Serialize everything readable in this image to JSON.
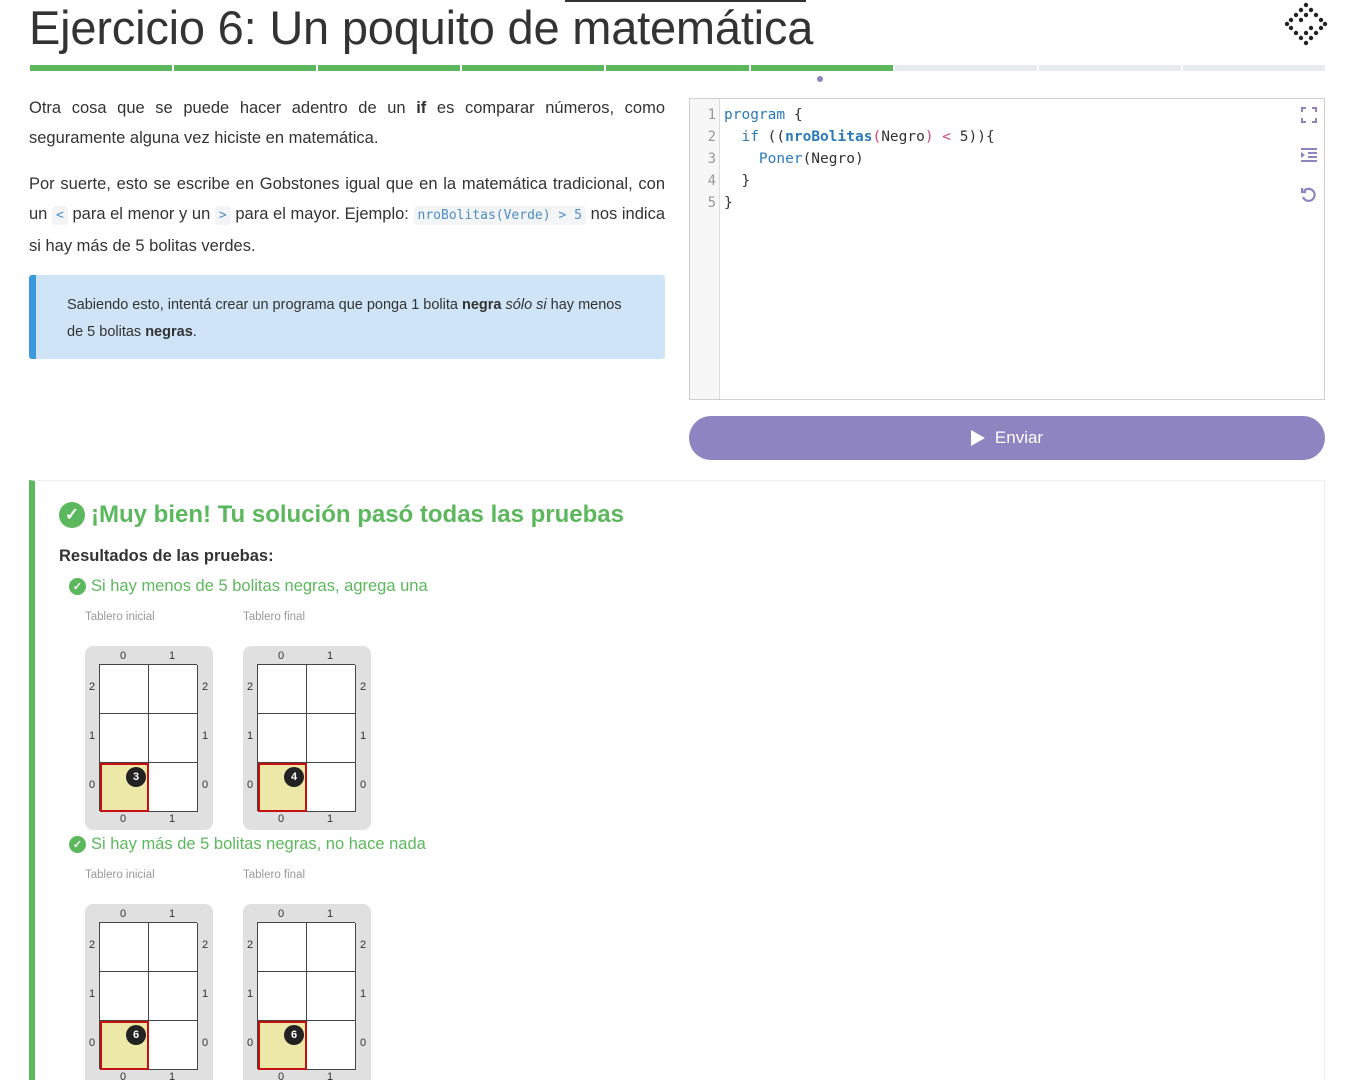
{
  "title": "Ejercicio 6: Un poquito de matemática",
  "progress": {
    "total": 9,
    "completed": 6
  },
  "description": {
    "p1_a": "Otra cosa que se puede hacer adentro de un ",
    "p1_kw": "if",
    "p1_b": " es comparar números, como seguramente alguna vez hiciste en matemática.",
    "p2_a": "Por suerte, esto se escribe en Gobstones igual que en la matemática tradicional, con un ",
    "p2_lt": "<",
    "p2_b": " para el menor y un ",
    "p2_gt": ">",
    "p2_c": " para el mayor. Ejemplo: ",
    "p2_example": "nroBolitas(Verde) > 5",
    "p2_d": " nos indica si hay más de 5 bolitas verdes."
  },
  "callout": {
    "a": "Sabiendo esto, intentá crear un programa que ponga 1 bolita ",
    "b": "negra",
    "c": "sólo si",
    "d": " hay menos de 5 bolitas ",
    "e": "negras",
    "f": "."
  },
  "editor": {
    "line_numbers": [
      "1",
      "2",
      "3",
      "4",
      "5"
    ],
    "lines": {
      "l1_kw": "program",
      "l1_rest": " {",
      "l2_indent": "  ",
      "l2_kw": "if",
      "l2_a": " ((",
      "l2_fn": "nroBolitas",
      "l2_paren1": "(",
      "l2_arg": "Negro",
      "l2_paren2": ")",
      "l2_op": " < ",
      "l2_num": "5",
      "l2_end": ")){",
      "l3_indent": "    ",
      "l3_proc": "Poner",
      "l3_rest": "(Negro)",
      "l4": "  }",
      "l5": "}"
    },
    "icons": [
      "expand-icon",
      "indent-icon",
      "reset-icon"
    ]
  },
  "submit_label": "Enviar",
  "results": {
    "title": "¡Muy bien! Tu solución pasó todas las pruebas",
    "subtitle": "Resultados de las pruebas:",
    "tests": [
      {
        "title": "Si hay menos de 5 bolitas negras, agrega una",
        "initial_label": "Tablero inicial",
        "final_label": "Tablero final",
        "initial_black": "3",
        "final_black": "4"
      },
      {
        "title": "Si hay más de 5 bolitas negras, no hace nada",
        "initial_label": "Tablero inicial",
        "final_label": "Tablero final",
        "initial_black": "6",
        "final_black": "6"
      }
    ],
    "board": {
      "col_labels": [
        "0",
        "1"
      ],
      "row_labels": [
        "2",
        "1",
        "0"
      ]
    }
  }
}
